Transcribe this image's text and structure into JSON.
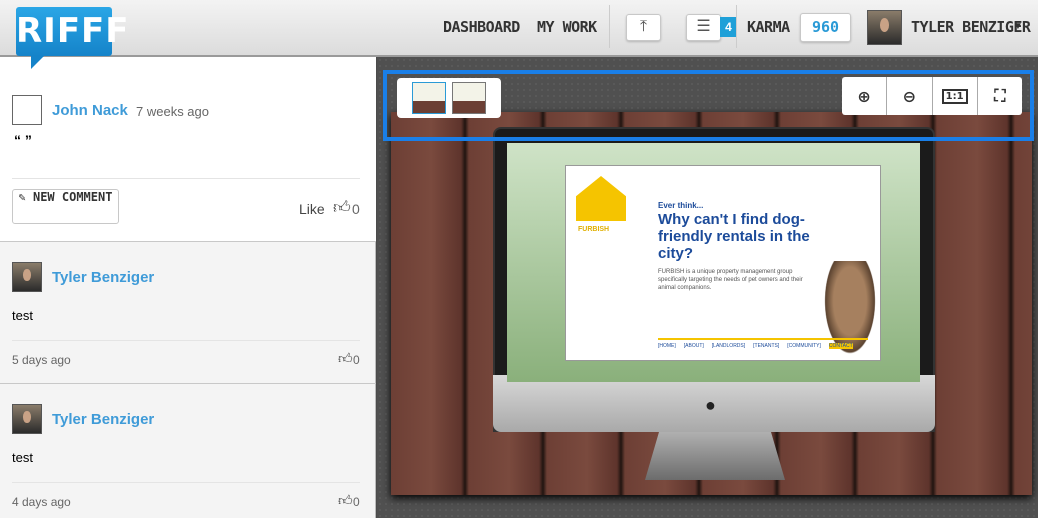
{
  "header": {
    "logo": "RIFFF",
    "nav": [
      "DASHBOARD",
      "MY WORK"
    ],
    "upload_icon": "upload-icon",
    "list_icon": "list-icon",
    "list_count": "4",
    "karma_label": "KARMA",
    "karma_value": "960",
    "user_name": "TYLER BENZIGER"
  },
  "post": {
    "author": "John Nack",
    "time": "7 weeks ago",
    "body": "“ ”",
    "new_comment_label": "NEW COMMENT",
    "like_label": "Like",
    "like_count": "0"
  },
  "comments": [
    {
      "author": "Tyler Benziger",
      "body": "test",
      "time": "5 days ago",
      "likes": "0"
    },
    {
      "author": "Tyler Benziger",
      "body": "test",
      "time": "4 days ago",
      "likes": "0"
    }
  ],
  "viewer": {
    "zoom_controls": [
      "zoom-in",
      "zoom-out",
      "1:1",
      "fit-screen"
    ],
    "actual_size_label": "1:1",
    "preview": {
      "brand": "FURBISH",
      "kicker": "Ever think...",
      "headline": "Why can't I find dog-friendly rentals in the city?",
      "blurb": "FURBISH is a unique property management group specifically targeting the needs of pet owners and their animal companions.",
      "site_nav": [
        "[HOME]",
        "[ABOUT]",
        "[LANDLORDS]",
        "[TENANTS]",
        "[COMMUNITY]",
        "CONTACT"
      ]
    }
  },
  "colors": {
    "accent": "#3f9bd8",
    "highlight": "#1a7fe8",
    "badge": "#1fa0d8"
  }
}
